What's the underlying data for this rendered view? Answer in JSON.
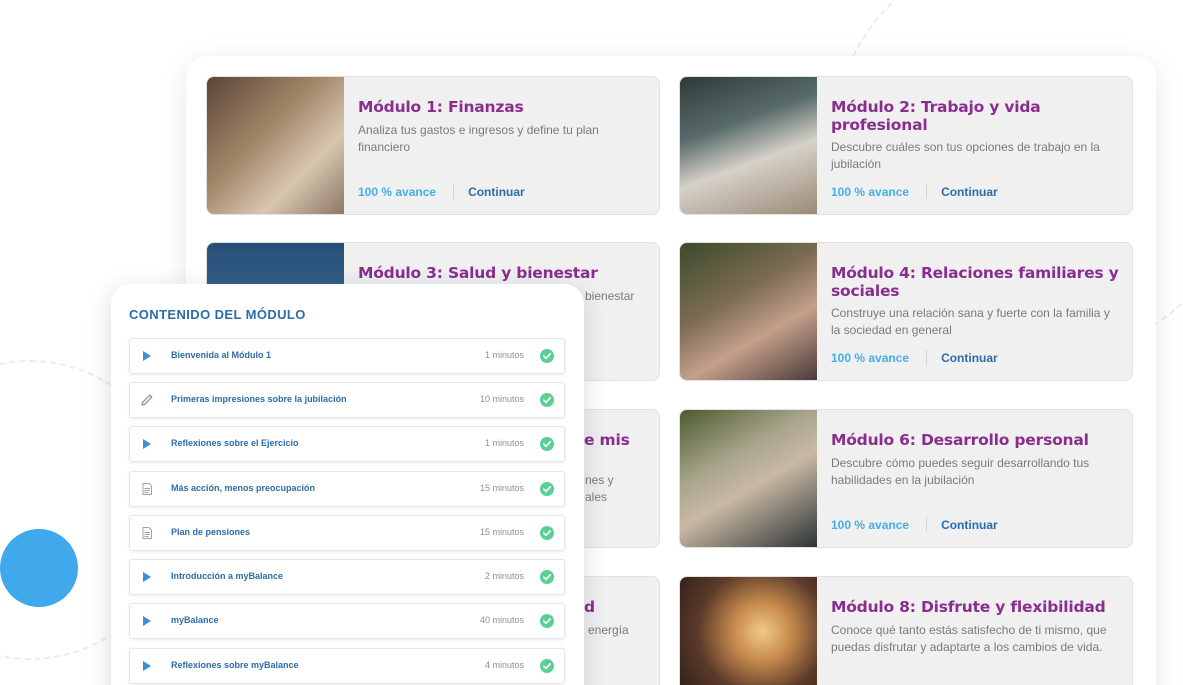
{
  "colors": {
    "accent_purple": "#8a2d8f",
    "progress_blue": "#45aee9",
    "link_blue": "#2c6da8",
    "check_green": "#5ccf96",
    "dot_blue": "#3fa9ec"
  },
  "modules": [
    {
      "title": "Módulo 1: Finanzas",
      "desc": "Analiza tus gastos e ingresos y define tu plan financiero",
      "progress": "100 % avance",
      "continue": "Continuar"
    },
    {
      "title": "Módulo 2: Trabajo y vida profesional",
      "desc": "Descubre cuáles son tus opciones de trabajo en la jubilación",
      "progress": "100 % avance",
      "continue": "Continuar"
    },
    {
      "title": "Módulo 3: Salud y bienestar",
      "desc": "bienestar"
    },
    {
      "title": "Módulo 4: Relaciones familiares y sociales",
      "desc": "Construye una relación sana y fuerte con la familia y la sociedad en general",
      "progress": "100 % avance",
      "continue": "Continuar"
    },
    {
      "title": "e mis",
      "desc": "nes y\nales"
    },
    {
      "title": "Módulo 6: Desarrollo personal",
      "desc": "Descubre cómo puedes seguir desarrollando tus habilidades en la jubilación",
      "progress": "100 % avance",
      "continue": "Continuar"
    },
    {
      "title": "d",
      "desc": "energía"
    },
    {
      "title": "Módulo 8: Disfrute y flexibilidad",
      "desc": "Conoce qué tanto estás satisfecho de ti mismo, que puedas disfrutar y adaptarte a los cambios de vida."
    }
  ],
  "content_panel": {
    "title": "CONTENIDO DEL MÓDULO",
    "lessons": [
      {
        "icon": "play-icon",
        "label": "Bienvenida al Módulo 1",
        "time": "1 minutos"
      },
      {
        "icon": "pencil-icon",
        "label": "Primeras impresiones sobre la jubilación",
        "time": "10 minutos"
      },
      {
        "icon": "play-icon",
        "label": "Reflexiones sobre el Ejercicio",
        "time": "1 minutos"
      },
      {
        "icon": "document-icon",
        "label": "Más acción, menos preocupación",
        "time": "15 minutos"
      },
      {
        "icon": "document-icon",
        "label": "Plan de pensiones",
        "time": "15 minutos"
      },
      {
        "icon": "play-icon",
        "label": "Introducción a myBalance",
        "time": "2 minutos"
      },
      {
        "icon": "play-icon",
        "label": "myBalance",
        "time": "40 minutos"
      },
      {
        "icon": "play-icon",
        "label": "Reflexiones sobre myBalance",
        "time": "4 minutos"
      }
    ]
  }
}
